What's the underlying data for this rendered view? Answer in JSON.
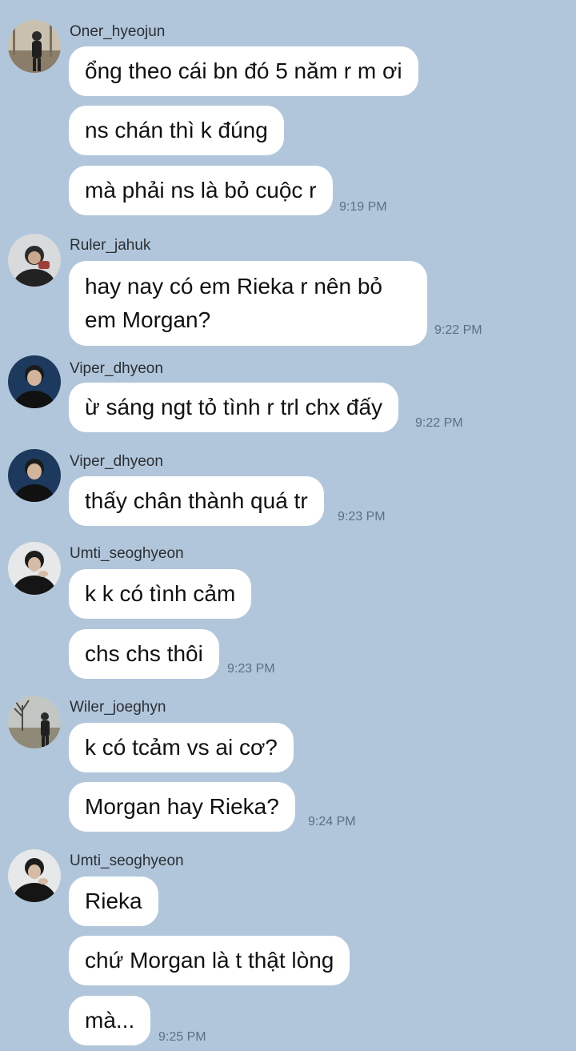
{
  "messages": [
    {
      "sender": "Oner_hyeojun",
      "avatar": "scene-avatar",
      "texts": [
        "ổng theo cái bn đó 5 năm r m ơi",
        "ns chán thì k đúng",
        "mà phải ns là bỏ cuộc r"
      ],
      "time": "9:19 PM"
    },
    {
      "sender": "Ruler_jahuk",
      "avatar": "portrait-avatar",
      "texts": [
        "hay nay có em Rieka r nên bỏ em Morgan?"
      ],
      "time": "9:22 PM"
    },
    {
      "sender": "Viper_dhyeon",
      "avatar": "portrait-avatar",
      "texts": [
        "ừ sáng ngt tỏ tình r trl chx đấy"
      ],
      "time": "9:22 PM"
    },
    {
      "sender": "Viper_dhyeon",
      "avatar": "portrait-avatar",
      "texts": [
        "thấy chân thành quá tr"
      ],
      "time": "9:23 PM"
    },
    {
      "sender": "Umti_seoghyeon",
      "avatar": "portrait-avatar",
      "texts": [
        "k k có tình cảm",
        "chs chs thôi"
      ],
      "time": "9:23 PM"
    },
    {
      "sender": "Wiler_joeghyn",
      "avatar": "scene-avatar",
      "texts": [
        "k có tcảm vs ai cơ?",
        "Morgan hay Rieka?"
      ],
      "time": "9:24 PM"
    },
    {
      "sender": "Umti_seoghyeon",
      "avatar": "portrait-avatar",
      "texts": [
        "Rieka",
        "chứ Morgan là t thật lòng",
        "mà..."
      ],
      "time": "9:25 PM"
    }
  ]
}
